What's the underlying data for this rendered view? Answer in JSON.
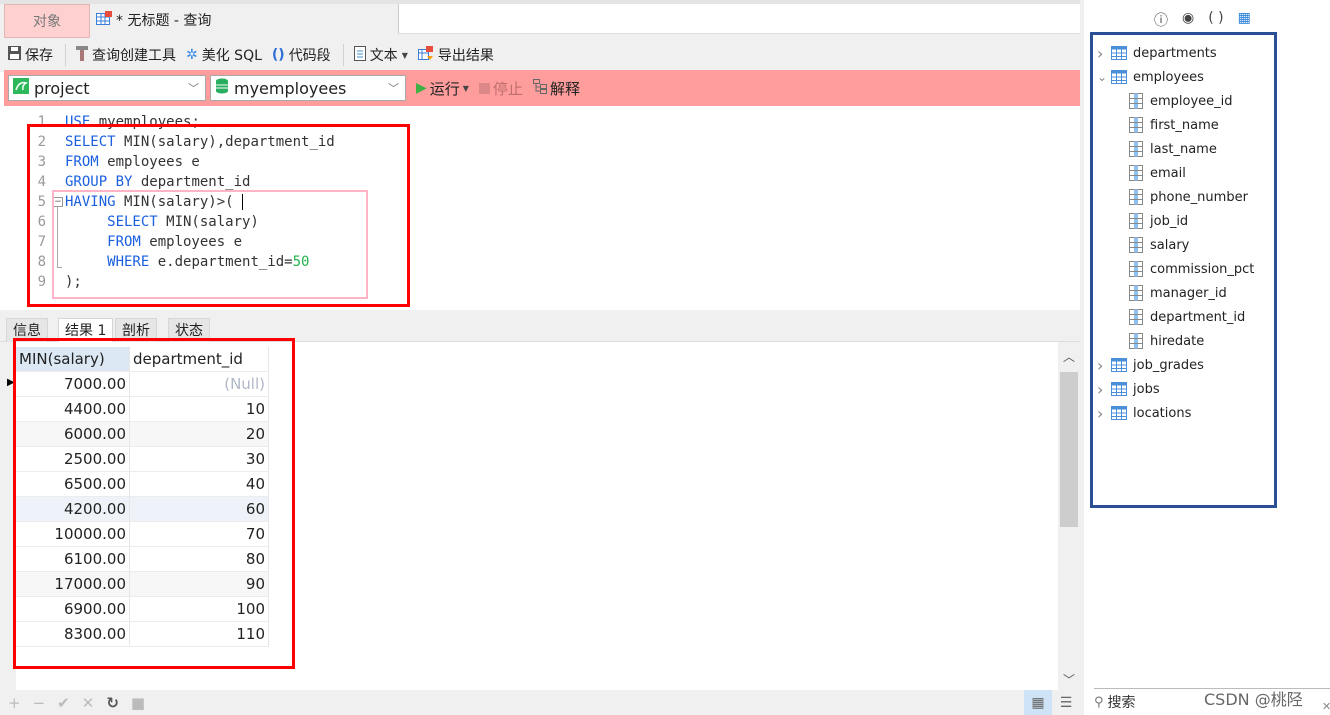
{
  "tabs": {
    "object_tab": "对象",
    "query_tab": "* 无标题 - 查询"
  },
  "toolbar": {
    "save": "保存",
    "query_builder": "查询创建工具",
    "beautify_sql": "美化 SQL",
    "code_snippet": "代码段",
    "text": "文本",
    "export_results": "导出结果"
  },
  "connection_bar": {
    "connection": "project",
    "database": "myemployees",
    "run": "运行",
    "stop": "停止",
    "explain": "解释",
    "accent_color": "#ff9c9c"
  },
  "editor": {
    "lines": [
      {
        "n": "1",
        "tokens": [
          {
            "t": "USE",
            "c": "kw"
          },
          {
            "t": " myemployees;",
            "c": "txt"
          }
        ]
      },
      {
        "n": "2",
        "tokens": [
          {
            "t": "SELECT",
            "c": "kw"
          },
          {
            "t": " MIN(salary),department_id",
            "c": "txt"
          }
        ]
      },
      {
        "n": "3",
        "tokens": [
          {
            "t": "FROM",
            "c": "kw"
          },
          {
            "t": " employees e",
            "c": "txt"
          }
        ]
      },
      {
        "n": "4",
        "tokens": [
          {
            "t": "GROUP BY",
            "c": "kw"
          },
          {
            "t": " department_id",
            "c": "txt"
          }
        ]
      },
      {
        "n": "5",
        "tokens": [
          {
            "t": "HAVING",
            "c": "kw"
          },
          {
            "t": " MIN(salary)>(",
            "c": "txt"
          }
        ]
      },
      {
        "n": "6",
        "tokens": [
          {
            "t": "     SELECT",
            "c": "kw"
          },
          {
            "t": " MIN(salary)",
            "c": "txt"
          }
        ]
      },
      {
        "n": "7",
        "tokens": [
          {
            "t": "     FROM",
            "c": "kw"
          },
          {
            "t": " employees e",
            "c": "txt"
          }
        ]
      },
      {
        "n": "8",
        "tokens": [
          {
            "t": "     WHERE",
            "c": "kw"
          },
          {
            "t": " e.department_id=",
            "c": "txt"
          },
          {
            "t": "50",
            "c": "num"
          }
        ]
      },
      {
        "n": "9",
        "tokens": [
          {
            "t": ");",
            "c": "txt"
          }
        ]
      }
    ]
  },
  "result_tabs": [
    "信息",
    "结果 1",
    "剖析",
    "状态"
  ],
  "result_grid": {
    "columns": [
      "MIN(salary)",
      "department_id"
    ],
    "rows": [
      [
        "7000.00",
        "(Null)"
      ],
      [
        "4400.00",
        "10"
      ],
      [
        "6000.00",
        "20"
      ],
      [
        "2500.00",
        "30"
      ],
      [
        "6500.00",
        "40"
      ],
      [
        "4200.00",
        "60"
      ],
      [
        "10000.00",
        "70"
      ],
      [
        "6100.00",
        "80"
      ],
      [
        "17000.00",
        "90"
      ],
      [
        "6900.00",
        "100"
      ],
      [
        "8300.00",
        "110"
      ]
    ]
  },
  "bottom_bar": {
    "icons": [
      "add-icon",
      "remove-icon",
      "apply-icon",
      "discard-icon",
      "refresh-icon",
      "stop-icon"
    ]
  },
  "right_panel": {
    "tree": [
      {
        "label": "departments",
        "type": "table",
        "expanded": false
      },
      {
        "label": "employees",
        "type": "table",
        "expanded": true,
        "columns": [
          "employee_id",
          "first_name",
          "last_name",
          "email",
          "phone_number",
          "job_id",
          "salary",
          "commission_pct",
          "manager_id",
          "department_id",
          "hiredate"
        ]
      },
      {
        "label": "job_grades",
        "type": "table",
        "expanded": false
      },
      {
        "label": "jobs",
        "type": "table",
        "expanded": false
      },
      {
        "label": "locations",
        "type": "table",
        "expanded": false
      }
    ],
    "search_label": "搜索",
    "watermark": "CSDN @桃陉"
  }
}
